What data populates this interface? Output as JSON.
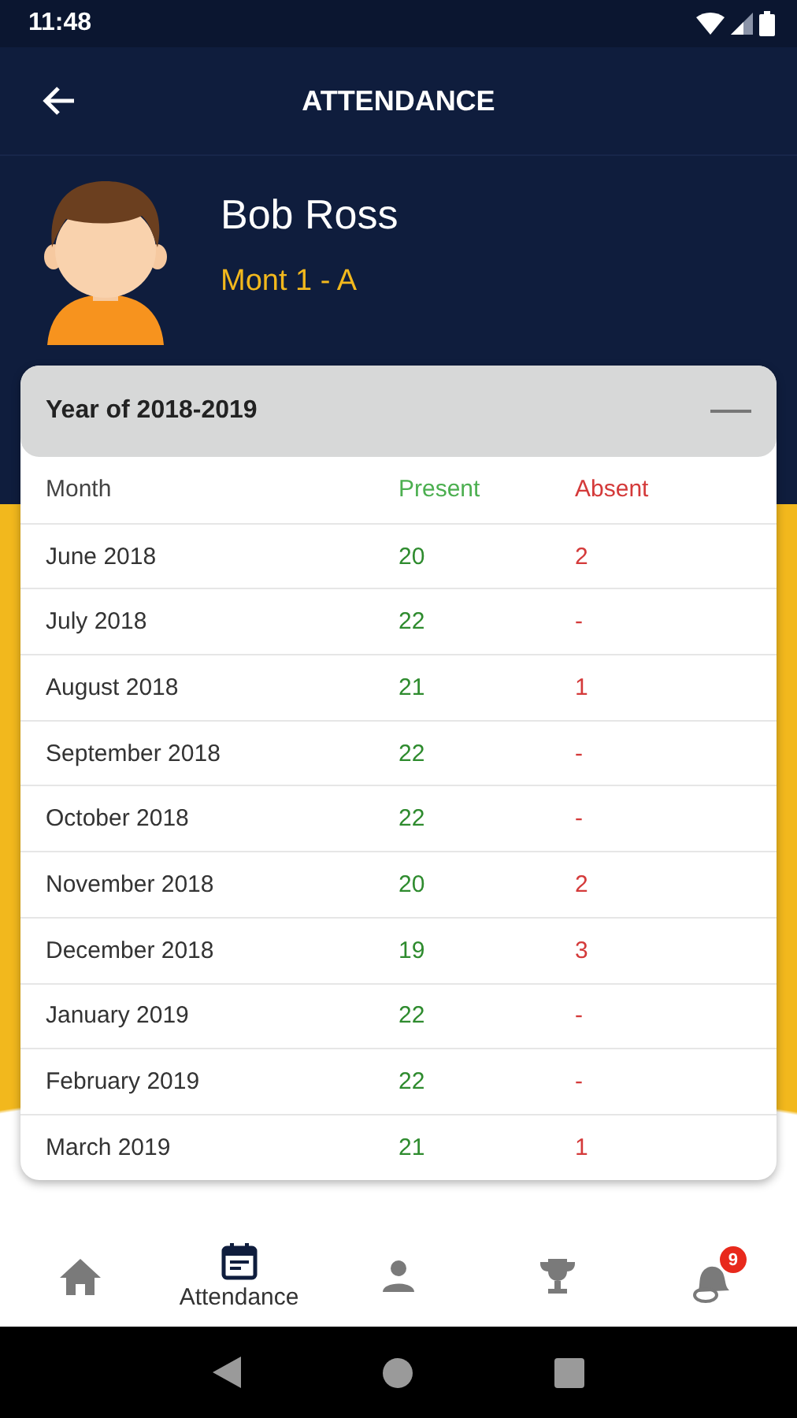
{
  "status_bar": {
    "time": "11:48"
  },
  "app_bar": {
    "title": "ATTENDANCE"
  },
  "profile": {
    "name": "Bob Ross",
    "class": "Mont 1 - A"
  },
  "year_panel": {
    "title": "Year of 2018-2019",
    "expanded": true,
    "columns": [
      "Month",
      "Present",
      "Absent"
    ],
    "rows": [
      {
        "month": "June 2018",
        "present": "20",
        "absent": "2"
      },
      {
        "month": "July 2018",
        "present": "22",
        "absent": "-"
      },
      {
        "month": "August 2018",
        "present": "21",
        "absent": "1"
      },
      {
        "month": "September 2018",
        "present": "22",
        "absent": "-"
      },
      {
        "month": "October 2018",
        "present": "22",
        "absent": "-"
      },
      {
        "month": "November 2018",
        "present": "20",
        "absent": "2"
      },
      {
        "month": "December 2018",
        "present": "19",
        "absent": "3"
      },
      {
        "month": "January 2019",
        "present": "22",
        "absent": "-"
      },
      {
        "month": "February 2019",
        "present": "22",
        "absent": "-"
      },
      {
        "month": "March 2019",
        "present": "21",
        "absent": "1"
      }
    ]
  },
  "bottom_nav": [
    {
      "kind": "home",
      "selected": false
    },
    {
      "kind": "attendance",
      "label": "Attendance",
      "selected": true
    },
    {
      "kind": "profile",
      "selected": false
    },
    {
      "kind": "trophy",
      "selected": false
    },
    {
      "kind": "bell",
      "badge": "9",
      "selected": false
    }
  ]
}
